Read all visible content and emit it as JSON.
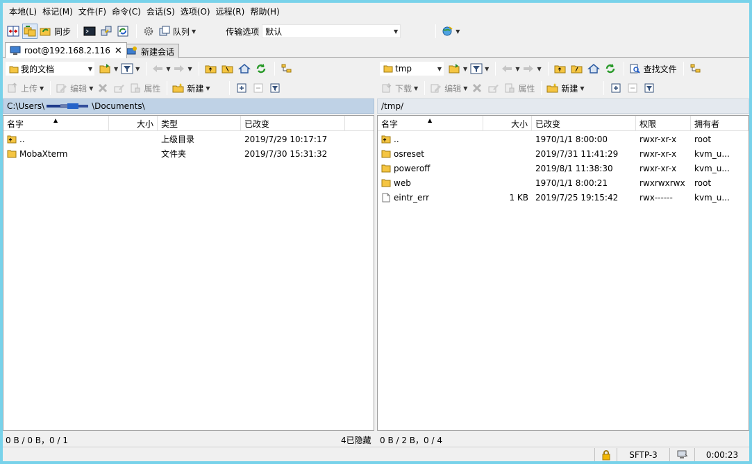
{
  "menu": [
    "本地(L)",
    "标记(M)",
    "文件(F)",
    "命令(C)",
    "会话(S)",
    "选项(O)",
    "远程(R)",
    "帮助(H)"
  ],
  "toolbar": {
    "sync_label": "同步",
    "queue_label": "队列",
    "transfer_options_label": "传输选项",
    "transfer_preset": "默认"
  },
  "tabs": [
    {
      "label": "root@192.168.2.116",
      "close": "✕"
    },
    {
      "label": "新建会话"
    }
  ],
  "left": {
    "location": "我的文档",
    "upload_label": "上传",
    "edit_label": "编辑",
    "properties_label": "属性",
    "new_label": "新建",
    "path": "C:\\Users\\",
    "path_tail": "\\Documents\\",
    "columns": [
      "名字",
      "大小",
      "类型",
      "已改变"
    ],
    "rows": [
      {
        "name": "..",
        "size": "",
        "type": "上级目录",
        "changed": "2019/7/29  10:17:17",
        "icon": "parent-folder"
      },
      {
        "name": "MobaXterm",
        "size": "",
        "type": "文件夹",
        "changed": "2019/7/30  15:31:32",
        "icon": "folder"
      }
    ],
    "status": "0 B / 0 B，0 / 1",
    "hidden": "4已隐藏"
  },
  "right": {
    "location": "tmp",
    "download_label": "下载",
    "edit_label": "编辑",
    "properties_label": "属性",
    "new_label": "新建",
    "find_label": "查找文件",
    "path": "/tmp/",
    "columns": [
      "名字",
      "大小",
      "已改变",
      "权限",
      "拥有者"
    ],
    "rows": [
      {
        "name": "..",
        "size": "",
        "changed": "1970/1/1 8:00:00",
        "perm": "rwxr-xr-x",
        "owner": "root",
        "icon": "parent-folder"
      },
      {
        "name": "osreset",
        "size": "",
        "changed": "2019/7/31 11:41:29",
        "perm": "rwxr-xr-x",
        "owner": "kvm_u...",
        "icon": "folder"
      },
      {
        "name": "poweroff",
        "size": "",
        "changed": "2019/8/1 11:38:30",
        "perm": "rwxr-xr-x",
        "owner": "kvm_u...",
        "icon": "folder"
      },
      {
        "name": "web",
        "size": "",
        "changed": "1970/1/1 8:00:21",
        "perm": "rwxrwxrwx",
        "owner": "root",
        "icon": "folder"
      },
      {
        "name": "eintr_err",
        "size": "1 KB",
        "changed": "2019/7/25 19:15:42",
        "perm": "rwx------",
        "owner": "kvm_u...",
        "icon": "file"
      }
    ],
    "status": "0 B / 2 B，0 / 4"
  },
  "statusbar": {
    "protocol": "SFTP-3",
    "elapsed": "0:00:23"
  }
}
